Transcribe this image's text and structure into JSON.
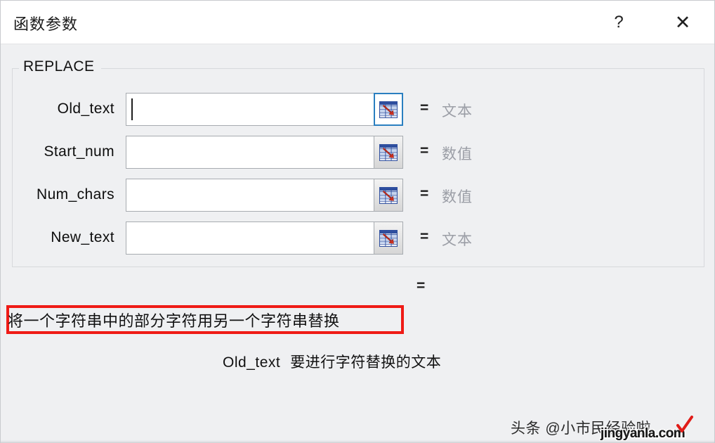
{
  "window": {
    "title": "函数参数",
    "help_label": "?",
    "close_label": "✕"
  },
  "group": {
    "label": "REPLACE"
  },
  "arguments": [
    {
      "label": "Old_text",
      "value": "",
      "equals": "=",
      "type_hint": "文本",
      "focused": true
    },
    {
      "label": "Start_num",
      "value": "",
      "equals": "=",
      "type_hint": "数值",
      "focused": false
    },
    {
      "label": "Num_chars",
      "value": "",
      "equals": "=",
      "type_hint": "数值",
      "focused": false
    },
    {
      "label": "New_text",
      "value": "",
      "equals": "=",
      "type_hint": "文本",
      "focused": false
    }
  ],
  "result": {
    "equals": "=",
    "value": ""
  },
  "description": "将一个字符串中的部分字符用另一个字符串替换",
  "param_help": {
    "name": "Old_text",
    "text": "要进行字符替换的文本"
  },
  "watermark": {
    "main": "头条 @小市民经验啦",
    "sub": "jingyanla.com"
  },
  "colors": {
    "dialog_bg": "#eff0f2",
    "titlebar_bg": "#ffffff",
    "annotation_red": "#ef1b16",
    "focus_blue": "#2a7fc0",
    "hint_gray": "#9b9ea6",
    "icon_blue": "#2e4e9e",
    "icon_red": "#d03020"
  },
  "icons": {
    "range_picker": "range-picker-icon"
  }
}
